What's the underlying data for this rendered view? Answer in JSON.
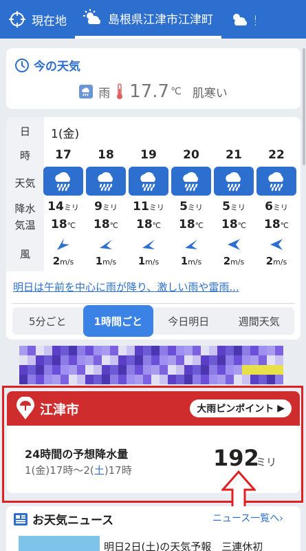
{
  "header": {
    "current_location_label": "現在地",
    "active_location_label": "島根県江津市江津町",
    "next_location_label": "野"
  },
  "now": {
    "title": "今の天気",
    "weather": "雨",
    "temperature": "17.7",
    "temp_unit": "℃",
    "feeling": "肌寒い"
  },
  "hourly": {
    "row_labels": {
      "day": "日",
      "hour": "時",
      "weather": "天気",
      "precip": "降水",
      "temp": "気温",
      "wind": "風"
    },
    "day": "1(金)",
    "hours": [
      {
        "hour": "17",
        "precip": "14",
        "temp": "18",
        "wind": "2"
      },
      {
        "hour": "18",
        "precip": "9",
        "temp": "18",
        "wind": "1"
      },
      {
        "hour": "19",
        "precip": "11",
        "temp": "18",
        "wind": "1"
      },
      {
        "hour": "20",
        "precip": "5",
        "temp": "18",
        "wind": "1"
      },
      {
        "hour": "21",
        "precip": "5",
        "temp": "18",
        "wind": "2"
      },
      {
        "hour": "22",
        "precip": "6",
        "temp": "18",
        "wind": "2"
      }
    ],
    "precip_unit": "ミリ",
    "temp_unit": "℃",
    "wind_unit": "m/s",
    "summary": "明日は午前を中心に雨が降り、激しい雨や雷雨..."
  },
  "segments": {
    "five_min": "5分ごと",
    "one_hour": "1時間ごと",
    "today_tomorrow": "今日明日",
    "weekly": "週間天気"
  },
  "heavy_rain": {
    "city": "江津市",
    "pinpoint_button": "大雨ピンポイント",
    "label": "24時間の予想降水量",
    "range_start": "1(金)17時〜2(",
    "range_day": "土",
    "range_end": ")17時",
    "amount": "192",
    "unit": "ミリ"
  },
  "news": {
    "title": "お天気ニュース",
    "more_link": "ニュース一覧へ›",
    "headline": "明日2日(土)の天気予報　三連休初"
  },
  "colors": {
    "brand_blue": "#2c6fcf",
    "alert_red": "#cf2d2d",
    "highlight_frame": "#e02020"
  }
}
